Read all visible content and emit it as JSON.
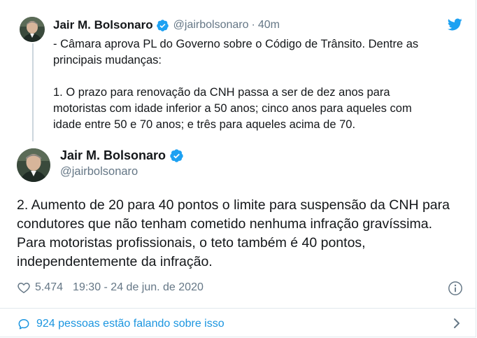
{
  "parent_tweet": {
    "author_name": "Jair M. Bolsonaro",
    "handle": "@jairbolsonaro",
    "separator": "·",
    "time": "40m",
    "text": "- Câmara aprova PL do Governo sobre o Código de Trânsito. Dentre as\nprincipais mudanças:\n\n1. O prazo para renovação da CNH passa a ser de dez anos para\nmotoristas com idade inferior a 50 anos; cinco anos para aqueles com\nidade entre 50 e 70 anos; e três para aqueles acima de 70."
  },
  "main_tweet": {
    "author_name": "Jair M. Bolsonaro",
    "handle": "@jairbolsonaro",
    "text": "2. Aumento de 20 para 40 pontos o limite para suspensão da CNH para condutores que não tenham cometido nenhuma infração gravíssima. Para motoristas profissionais, o teto também é 40 pontos, independentemente da infração.",
    "likes": "5.474",
    "timestamp": "19:30 - 24 de jun. de 2020"
  },
  "footer": {
    "talking_label": "924 pessoas estão falando sobre isso"
  },
  "icons": {
    "verified": "verified-badge-icon",
    "brand": "twitter-bird-icon",
    "like": "heart-icon",
    "info": "info-icon",
    "reply": "speech-bubble-icon",
    "more": "chevron-right-icon"
  },
  "colors": {
    "brand_blue": "#1da1f2",
    "link_blue": "#1b95e0",
    "secondary_text": "#657786",
    "divider": "#e1e8ed",
    "thread_line": "#ccd6dd"
  }
}
